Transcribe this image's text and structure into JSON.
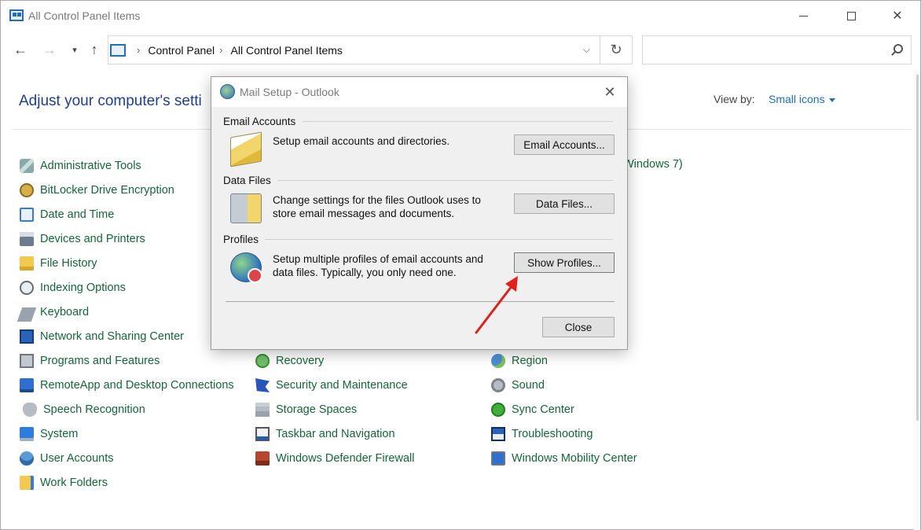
{
  "window": {
    "title": "All Control Panel Items"
  },
  "address_bar": {
    "crumbs": [
      "Control Panel",
      "All Control Panel Items"
    ],
    "search_placeholder": ""
  },
  "header": {
    "title": "Adjust your computer's setti",
    "view_by_label": "View by:",
    "view_by_value": "Small icons"
  },
  "partial_item": "Windows 7)",
  "items": {
    "col1": [
      {
        "label": "Administrative Tools",
        "icon": "administrative-tools-icon"
      },
      {
        "label": "BitLocker Drive Encryption",
        "icon": "bitlocker-icon"
      },
      {
        "label": "Date and Time",
        "icon": "date-time-icon"
      },
      {
        "label": "Devices and Printers",
        "icon": "printer-icon"
      },
      {
        "label": "File History",
        "icon": "file-history-icon"
      },
      {
        "label": "Indexing Options",
        "icon": "indexing-icon"
      },
      {
        "label": "Keyboard",
        "icon": "keyboard-icon"
      },
      {
        "label": "Network and Sharing Center",
        "icon": "network-icon"
      },
      {
        "label": "Programs and Features",
        "icon": "programs-icon"
      },
      {
        "label": "RemoteApp and Desktop Connections",
        "icon": "remoteapp-icon"
      },
      {
        "label": "Speech Recognition",
        "icon": "speech-icon"
      },
      {
        "label": "System",
        "icon": "system-icon"
      },
      {
        "label": "User Accounts",
        "icon": "user-accounts-icon"
      },
      {
        "label": "Work Folders",
        "icon": "work-folders-icon"
      }
    ],
    "col2": [
      {
        "label": "Recovery",
        "icon": "recovery-icon"
      },
      {
        "label": "Security and Maintenance",
        "icon": "security-flag-icon"
      },
      {
        "label": "Storage Spaces",
        "icon": "storage-icon"
      },
      {
        "label": "Taskbar and Navigation",
        "icon": "taskbar-icon"
      },
      {
        "label": "Windows Defender Firewall",
        "icon": "firewall-icon"
      }
    ],
    "col3": [
      {
        "label": "Region",
        "icon": "region-globe-icon"
      },
      {
        "label": "Sound",
        "icon": "sound-icon"
      },
      {
        "label": "Sync Center",
        "icon": "sync-icon"
      },
      {
        "label": "Troubleshooting",
        "icon": "troubleshooting-icon"
      },
      {
        "label": "Windows Mobility Center",
        "icon": "mobility-icon"
      }
    ]
  },
  "dialog": {
    "title": "Mail Setup - Outlook",
    "email_accounts": {
      "label": "Email Accounts",
      "description": "Setup email accounts and directories.",
      "button": "Email Accounts..."
    },
    "data_files": {
      "label": "Data Files",
      "description_line1": "Change settings for the files Outlook uses to",
      "description_line2": "store email messages and documents.",
      "button": "Data Files..."
    },
    "profiles": {
      "label": "Profiles",
      "description_line1": "Setup multiple profiles of email accounts and",
      "description_line2": "data files. Typically, you only need one.",
      "button": "Show Profiles..."
    },
    "close_button": "Close"
  },
  "colors": {
    "link_green": "#16653a",
    "heading_blue": "#1e3f8f",
    "accent_blue": "#1e6fb8",
    "annotation_red": "#e0201b"
  }
}
